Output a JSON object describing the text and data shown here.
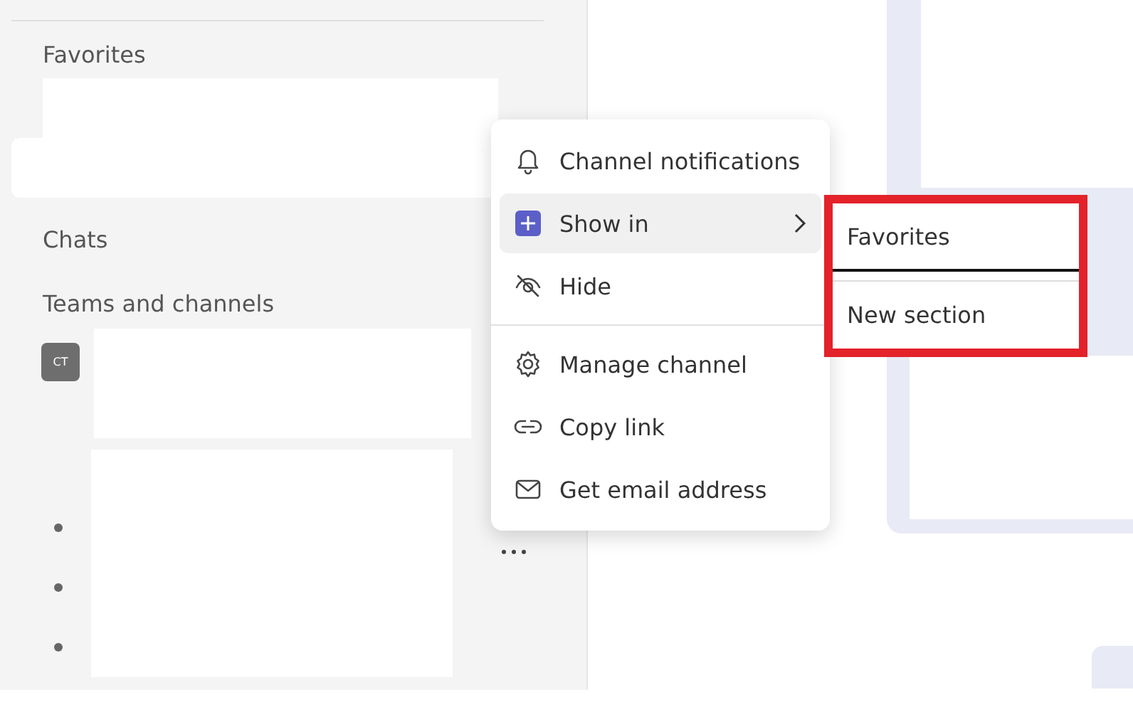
{
  "sidebar": {
    "favorites_label": "Favorites",
    "chats_label": "Chats",
    "teams_label": "Teams and channels",
    "team_avatar": "CT"
  },
  "context_menu": {
    "groups": [
      [
        {
          "label": "Channel notifications",
          "selected": false,
          "has_submenu": false
        },
        {
          "label": "Show in",
          "selected": true,
          "has_submenu": true
        },
        {
          "label": "Hide",
          "selected": false,
          "has_submenu": false
        }
      ],
      [
        {
          "label": "Manage channel",
          "selected": false,
          "has_submenu": false
        },
        {
          "label": "Copy link",
          "selected": false,
          "has_submenu": false
        },
        {
          "label": "Get email address",
          "selected": false,
          "has_submenu": false
        }
      ]
    ]
  },
  "submenu": {
    "highlighted": true,
    "items": [
      {
        "label": "Favorites",
        "selected": true
      },
      {
        "label": "New section",
        "selected": false
      }
    ]
  }
}
